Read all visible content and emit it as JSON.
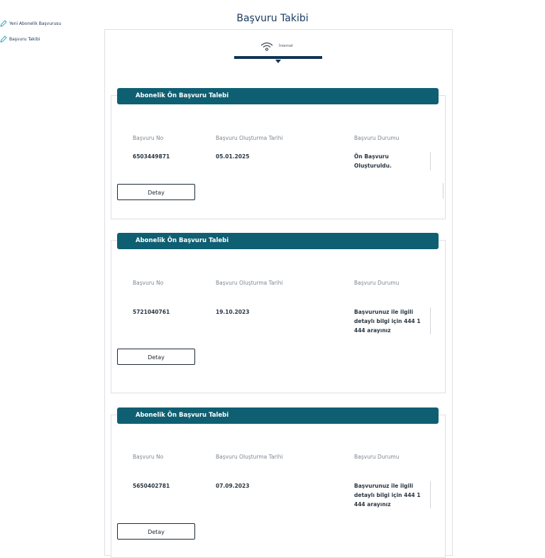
{
  "sidebar": {
    "items": [
      {
        "label": "Yeni Abonelik Başvurusu",
        "icon": "pencil-icon"
      },
      {
        "label": "Başvuru Takibi",
        "icon": "pencil-icon"
      }
    ]
  },
  "page": {
    "title": "Başvuru Takibi"
  },
  "tabs": [
    {
      "label": "İnternet",
      "icon": "wifi-icon",
      "active": true
    }
  ],
  "colors": {
    "header": "#0f5f72",
    "title": "#163a5f",
    "tab_underline": "#0f3355"
  },
  "applications": [
    {
      "header": "Abonelik Ön Başvuru Talebi",
      "labels": {
        "no": "Başvuru No",
        "date": "Başvuru Oluşturma Tarihi",
        "status": "Başvuru Durumu"
      },
      "no": "6503449871",
      "date": "05.01.2025",
      "status": "Ön Başvuru Oluşturuldu.",
      "button": "Detay"
    },
    {
      "header": "Abonelik Ön Başvuru Talebi",
      "labels": {
        "no": "Başvuru No",
        "date": "Başvuru Oluşturma Tarihi",
        "status": "Başvuru Durumu"
      },
      "no": "5721040761",
      "date": "19.10.2023",
      "status": "Başvurunuz ile ilgili detaylı bilgi için 444 1 444 arayınız",
      "button": "Detay"
    },
    {
      "header": "Abonelik Ön Başvuru Talebi",
      "labels": {
        "no": "Başvuru No",
        "date": "Başvuru Oluşturma Tarihi",
        "status": "Başvuru Durumu"
      },
      "no": "5650402781",
      "date": "07.09.2023",
      "status": "Başvurunuz ile ilgili detaylı bilgi için 444 1 444 arayınız",
      "button": "Detay"
    }
  ]
}
